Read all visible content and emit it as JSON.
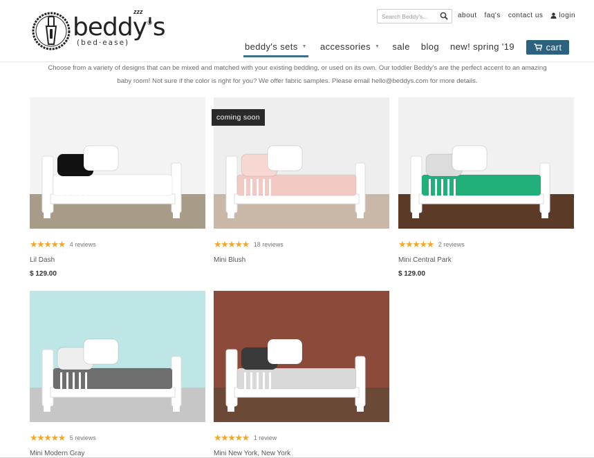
{
  "brand": {
    "name": "beddy's",
    "tagline": "(bed·ease)",
    "reg_mark": "®",
    "zzz": "zzz"
  },
  "search": {
    "placeholder": "Search Beddy's..."
  },
  "top_links": [
    {
      "label": "about"
    },
    {
      "label": "faq's"
    },
    {
      "label": "contact us"
    },
    {
      "label": "login"
    }
  ],
  "nav": [
    {
      "label": "beddy's sets",
      "caret": "▼",
      "active": true
    },
    {
      "label": "accessories",
      "caret": "▼"
    },
    {
      "label": "sale"
    },
    {
      "label": "blog"
    },
    {
      "label": "new! spring '19"
    }
  ],
  "cart": {
    "label": "cart"
  },
  "intro": {
    "line1": "Choose from a variety of designs that can be mixed and matched with your existing bedding, or used on its own. Our toddler Beddy's are the perfect accent to an amazing",
    "line2": "baby room!  Not sure if the color is right for you?  We offer fabric samples.  Please email hello@beddys.com for more details."
  },
  "products": [
    {
      "name": "Lil Dash",
      "stars": "★★★★★",
      "reviews": "4 reviews",
      "price": "$ 129.00",
      "badge": "",
      "icon": "bed-photo",
      "palette": {
        "wall": "#f3f3f3",
        "floor": "#a89b88",
        "blanket": "#ffffff",
        "accent": "#111111"
      }
    },
    {
      "name": "Mini Blush",
      "stars": "★★★★★",
      "reviews": "18 reviews",
      "price": "",
      "badge": "coming soon",
      "icon": "bed-photo",
      "palette": {
        "wall": "#eeeeee",
        "floor": "#c9b8a8",
        "blanket": "#f3c9c4",
        "accent": "#f7d7d2"
      }
    },
    {
      "name": "Mini Central Park",
      "stars": "★★★★★",
      "reviews": "2 reviews",
      "price": "$ 129.00",
      "badge": "",
      "icon": "bed-photo",
      "palette": {
        "wall": "#f1f1f1",
        "floor": "#5b3b28",
        "blanket": "#22b07a",
        "accent": "#dcdcdc"
      }
    },
    {
      "name": "Mini Modern Gray",
      "stars": "★★★★★",
      "reviews": "5 reviews",
      "price": "",
      "badge": "",
      "icon": "bed-photo",
      "palette": {
        "wall": "#bfe6e6",
        "floor": "#c6c6c6",
        "blanket": "#6e6e6e",
        "accent": "#eeeeee"
      }
    },
    {
      "name": "Mini New York, New York",
      "stars": "★★★★★",
      "reviews": "1 review",
      "price": "",
      "badge": "",
      "icon": "bed-photo",
      "palette": {
        "wall": "#8c4a3a",
        "floor": "#6a4a36",
        "blanket": "#d9d9d9",
        "accent": "#3a3a3a"
      }
    }
  ]
}
